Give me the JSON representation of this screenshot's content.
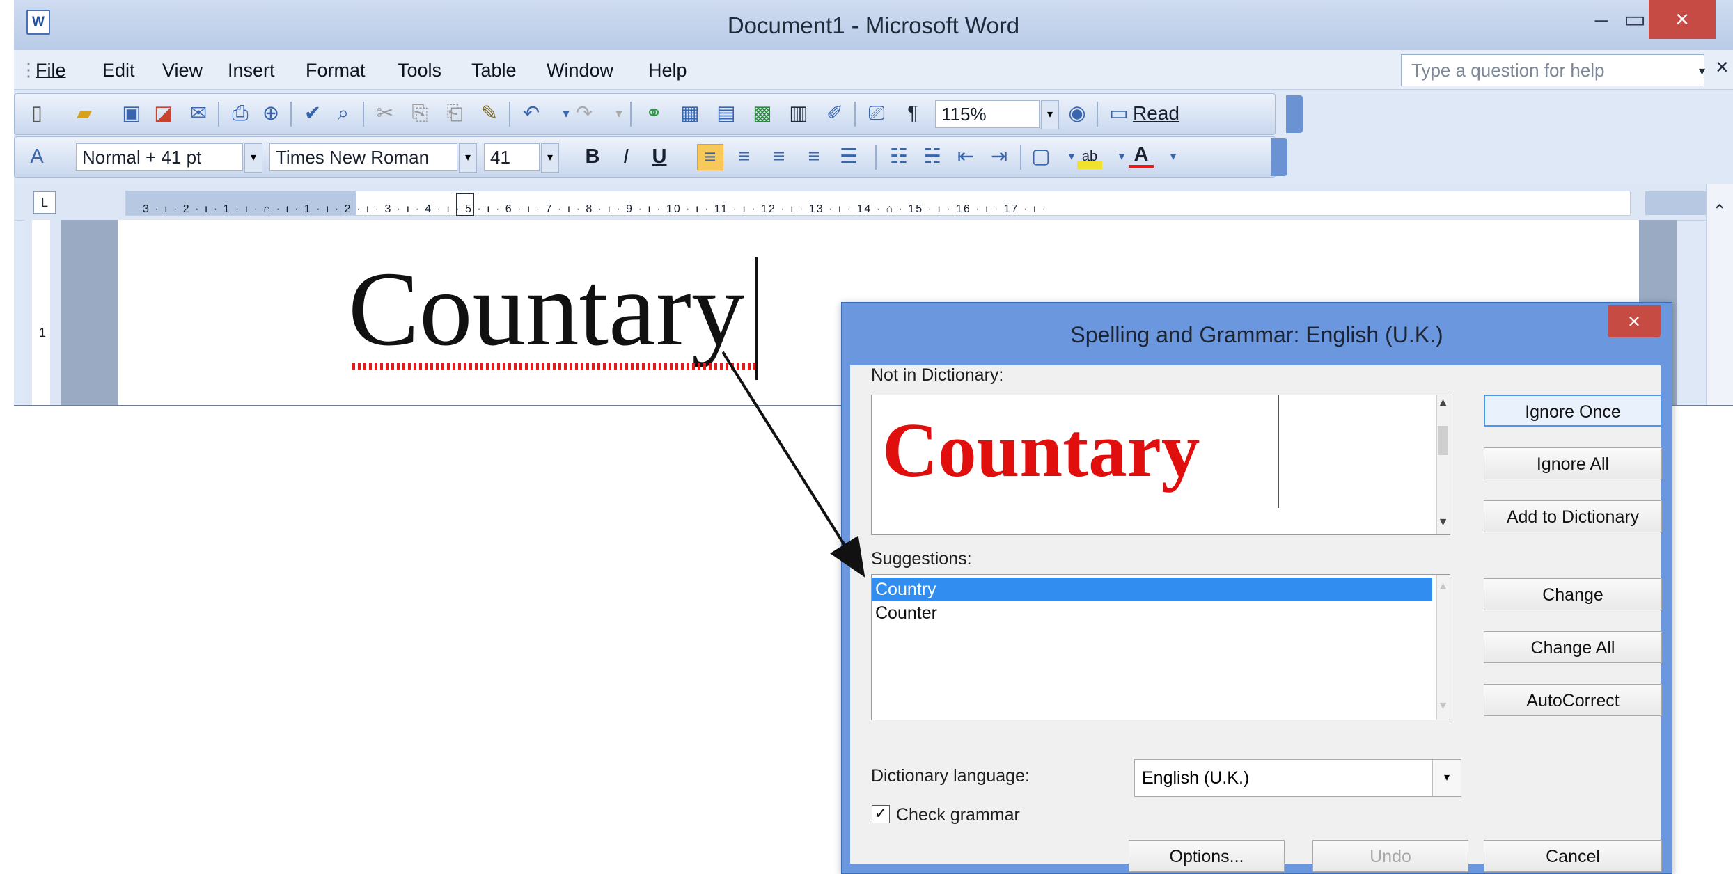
{
  "window": {
    "title": "Document1 - Microsoft Word",
    "app_icon": "W",
    "controls": {
      "minimize": "–",
      "maximize": "▭",
      "close": "×"
    }
  },
  "menu": {
    "items": [
      "File",
      "Edit",
      "View",
      "Insert",
      "Format",
      "Tools",
      "Table",
      "Window",
      "Help"
    ],
    "help_placeholder": "Type a question for help",
    "help_dropdown": "▾",
    "help_close": "×"
  },
  "toolbar_standard": {
    "icons": [
      "new-icon",
      "open-icon",
      "save-icon",
      "permission-icon",
      "email-icon",
      "print-icon",
      "print-preview-icon",
      "spelling-icon",
      "research-icon",
      "cut-icon",
      "copy-icon",
      "paste-icon",
      "format-painter-icon",
      "undo-icon",
      "redo-icon",
      "hyperlink-icon",
      "tables-borders-icon",
      "insert-table-icon",
      "insert-excel-icon",
      "columns-icon",
      "drawing-icon",
      "document-map-icon",
      "show-hide-icon"
    ],
    "zoom_value": "115%",
    "help_icon": "help-icon",
    "read_label": "Read"
  },
  "toolbar_formatting": {
    "style_value": "Normal + 41 pt",
    "font_value": "Times New Roman",
    "size_value": "41",
    "bold": "B",
    "italic": "I",
    "underline": "U",
    "highlight_label": "ab",
    "font_color_label": "A"
  },
  "ruler": {
    "tab_selector": "L",
    "scale": "3 · ı · 2 · ı · 1 · ı · ⌂ · ı · 1 · ı · 2 · ı · 3 · ı · 4 · ı · 5 · ı · 6 · ı · 7 · ı · 8 · ı · 9 · ı · 10 · ı · 11 · ı · 12 · ı · 13 · ı · 14 · ⌂ · 15 · ı · 16 · ı · 17 · ı ·",
    "vertical_mark": "1"
  },
  "document": {
    "text": "Countary"
  },
  "dialog": {
    "title": "Spelling and Grammar: English (U.K.)",
    "close": "×",
    "not_in_dictionary_label": "Not in Dictionary:",
    "misspelled_word": "Countary",
    "suggestions_label": "Suggestions:",
    "suggestions": [
      "Country",
      "Counter"
    ],
    "selected_suggestion": "Country",
    "dictionary_language_label": "Dictionary language:",
    "dictionary_language_value": "English (U.K.)",
    "check_grammar_label": "Check grammar",
    "check_grammar_checked": true,
    "buttons": {
      "ignore_once": "Ignore Once",
      "ignore_all": "Ignore All",
      "add_to_dictionary": "Add to Dictionary",
      "change": "Change",
      "change_all": "Change All",
      "autocorrect": "AutoCorrect",
      "options": "Options...",
      "undo": "Undo",
      "cancel": "Cancel"
    }
  },
  "colors": {
    "misspelled": "#e10e0e",
    "selection": "#318ef0",
    "dialog_frame": "#6b97df",
    "close_button": "#c64b43"
  }
}
